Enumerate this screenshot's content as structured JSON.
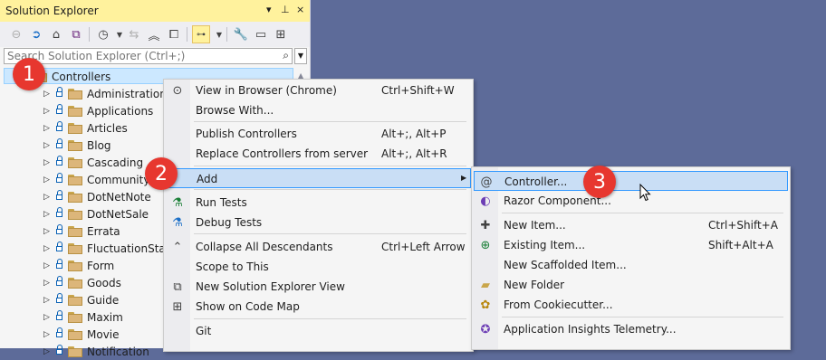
{
  "solution_explorer": {
    "title": "Solution Explorer",
    "title_controls": [
      "▾",
      "⊥",
      "×"
    ],
    "search": {
      "placeholder": "Search Solution Explorer (Ctrl+;)"
    },
    "selected_node": "Controllers",
    "folders": [
      "Administrations",
      "Applications",
      "Articles",
      "Blog",
      "Cascading",
      "CommunityC",
      "DotNetNote",
      "DotNetSale",
      "Errata",
      "FluctuationState",
      "Form",
      "Goods",
      "Guide",
      "Maxim",
      "Movie",
      "Notification"
    ]
  },
  "context_menu": {
    "items": [
      {
        "icon": "view-in-browser-icon",
        "label": "View in Browser (Chrome)",
        "shortcut": "Ctrl+Shift+W"
      },
      {
        "icon": "",
        "label": "Browse With...",
        "shortcut": ""
      },
      {
        "icon": "",
        "label": "Publish Controllers",
        "shortcut": "Alt+;, Alt+P"
      },
      {
        "icon": "",
        "label": "Replace Controllers from server",
        "shortcut": "Alt+;, Alt+R"
      },
      {
        "icon": "",
        "label": "Add",
        "shortcut": ""
      },
      {
        "icon": "run-tests-icon",
        "label": "Run Tests",
        "shortcut": ""
      },
      {
        "icon": "debug-tests-icon",
        "label": "Debug Tests",
        "shortcut": ""
      },
      {
        "icon": "collapse-icon",
        "label": "Collapse All Descendants",
        "shortcut": "Ctrl+Left Arrow"
      },
      {
        "icon": "",
        "label": "Scope to This",
        "shortcut": ""
      },
      {
        "icon": "new-view-icon",
        "label": "New Solution Explorer View",
        "shortcut": ""
      },
      {
        "icon": "code-map-icon",
        "label": "Show on Code Map",
        "shortcut": ""
      },
      {
        "icon": "",
        "label": "Git",
        "shortcut": ""
      }
    ]
  },
  "add_submenu": {
    "items": [
      {
        "icon": "controller-icon",
        "label": "Controller...",
        "shortcut": ""
      },
      {
        "icon": "razor-icon",
        "label": "Razor Component...",
        "shortcut": ""
      },
      {
        "icon": "new-item-icon",
        "label": "New Item...",
        "shortcut": "Ctrl+Shift+A"
      },
      {
        "icon": "existing-item-icon",
        "label": "Existing Item...",
        "shortcut": "Shift+Alt+A"
      },
      {
        "icon": "",
        "label": "New Scaffolded Item...",
        "shortcut": ""
      },
      {
        "icon": "new-folder-icon",
        "label": "New Folder",
        "shortcut": ""
      },
      {
        "icon": "cookiecutter-icon",
        "label": "From Cookiecutter...",
        "shortcut": ""
      },
      {
        "icon": "insights-icon",
        "label": "Application Insights Telemetry...",
        "shortcut": ""
      }
    ]
  },
  "callouts": [
    "1",
    "2",
    "3"
  ],
  "colors": {
    "background": "#5d6b99",
    "title_bar": "#fff29d",
    "menu_highlight": "#c9def5",
    "badge": "#e7372f"
  }
}
